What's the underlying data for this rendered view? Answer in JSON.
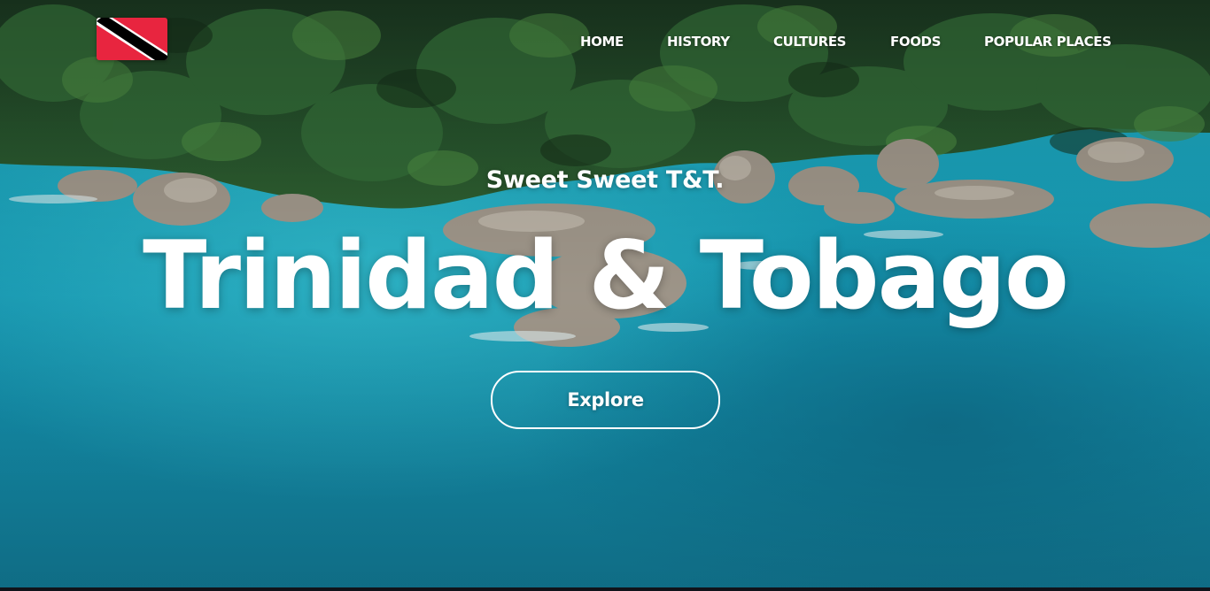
{
  "logo": {
    "icon": "trinidad-tobago-flag-icon",
    "colors": {
      "red": "#e8253f",
      "white": "#ffffff",
      "black": "#000000"
    }
  },
  "nav": {
    "items": [
      {
        "label": "HOME"
      },
      {
        "label": "HISTORY"
      },
      {
        "label": "CULTURES"
      },
      {
        "label": "FOODS"
      },
      {
        "label": "POPULAR PLACES"
      }
    ]
  },
  "hero": {
    "subtitle": "Sweet Sweet T&T.",
    "title": "Trinidad & Tobago",
    "cta_label": "Explore",
    "background": "aerial-tropical-coast-photo",
    "colors": {
      "water": "#1aa3bd",
      "foliage": "#1f4a26",
      "rock": "#a39a8d"
    }
  }
}
